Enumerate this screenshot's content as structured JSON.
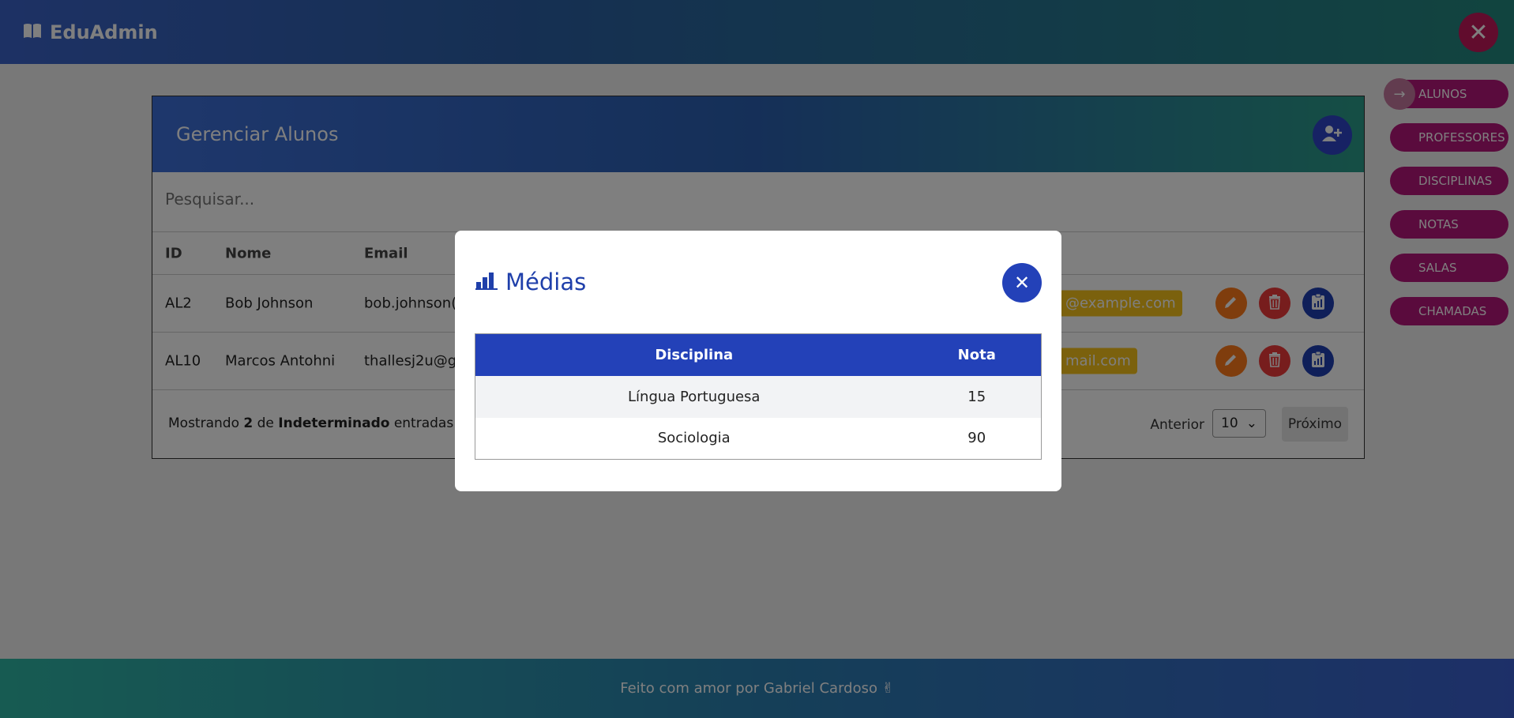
{
  "app": {
    "name": "EduAdmin"
  },
  "card": {
    "title": "Gerenciar Alunos",
    "search_placeholder": "Pesquisar...",
    "columns": [
      "ID",
      "Nome",
      "Email"
    ],
    "rows": [
      {
        "id": "AL2",
        "name": "Bob Johnson",
        "email": "bob.johnson(",
        "email_pill": "@example.com"
      },
      {
        "id": "AL10",
        "name": "Marcos Antohni",
        "email": "thallesj2u@g",
        "email_pill": "mail.com"
      }
    ],
    "footer": {
      "prefix": "Mostrando",
      "count": "2",
      "middle": "de",
      "total": "Indeterminado",
      "suffix": "entradas"
    },
    "pager": {
      "prev": "Anterior",
      "page_size": "10",
      "next": "Próximo"
    }
  },
  "sidenav": {
    "items": [
      "ALUNOS",
      "PROFESSORES",
      "DISCIPLINAS",
      "NOTAS",
      "SALAS",
      "CHAMADAS"
    ]
  },
  "page_footer": {
    "text": "Feito com amor por Gabriel Cardoso ✌"
  },
  "modal": {
    "title": "Médias",
    "columns": [
      "Disciplina",
      "Nota"
    ],
    "rows": [
      {
        "disciplina": "Língua Portuguesa",
        "nota": "15"
      },
      {
        "disciplina": "Sociologia",
        "nota": "90"
      }
    ]
  },
  "colors": {
    "primary": "#2341b8",
    "accent": "#b5177a",
    "warning": "#f7c21a"
  }
}
